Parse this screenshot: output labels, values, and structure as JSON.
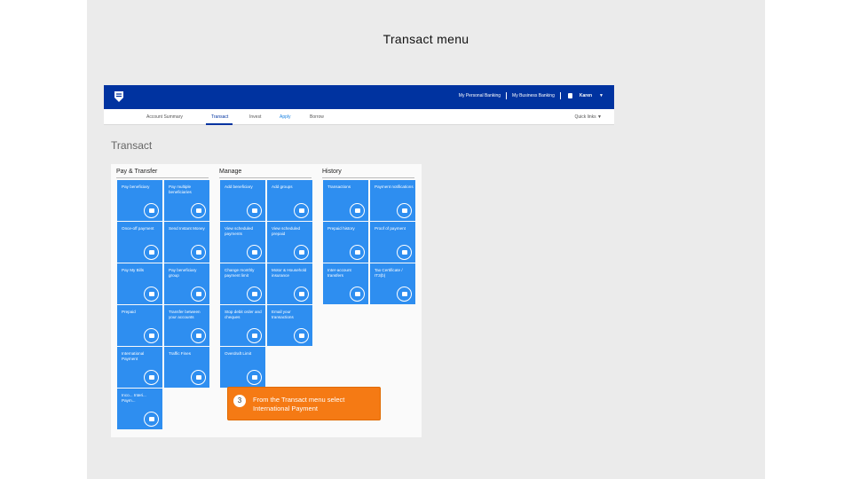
{
  "slide": {
    "title": "Transact menu"
  },
  "topbar": {
    "links": [
      "My Personal Banking",
      "My Business Banking"
    ],
    "user": "Karen"
  },
  "subnav": {
    "tabs": [
      "Account Summary",
      "Transact",
      "Invest",
      "Apply",
      "Borrow"
    ],
    "quick_links": "Quick links"
  },
  "page": {
    "heading": "Transact"
  },
  "sections": {
    "pay": "Pay & Transfer",
    "manage": "Manage",
    "history": "History"
  },
  "tiles": {
    "pay": [
      "Pay beneficiary",
      "Pay multiple beneficiaries",
      "Once-off payment",
      "Send Instant Money",
      "Pay My Bills",
      "Pay beneficiary group",
      "Prepaid",
      "Transfer between your accounts",
      "International Payment",
      "Traffic Fines",
      "Inco... Interi... Paym..."
    ],
    "manage": [
      "Add beneficiary",
      "Add groups",
      "View scheduled payments",
      "View scheduled prepaid",
      "Change monthly payment limit",
      "Motor & Household insurance",
      "Stop debit order and cheques",
      "Email your transactions",
      "Overdraft Limit"
    ],
    "history": [
      "Transactions",
      "Payment notifications",
      "Prepaid history",
      "Proof of payment",
      "Inter-account transfers",
      "Tax Certificate / IT3(b)"
    ]
  },
  "callout": {
    "step": "3",
    "text": "From the Transact menu select International Payment"
  }
}
